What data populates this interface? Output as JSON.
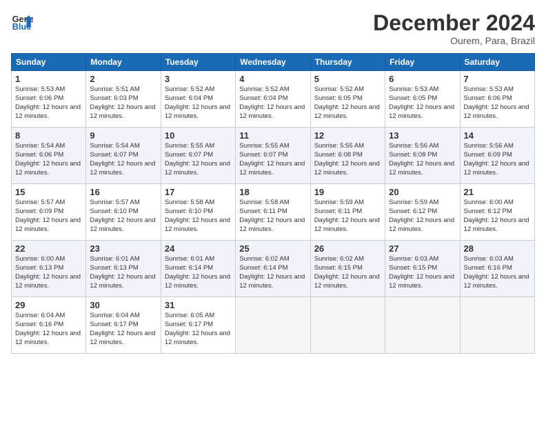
{
  "logo": {
    "line1": "General",
    "line2": "Blue"
  },
  "header": {
    "month": "December 2024",
    "location": "Ourem, Para, Brazil"
  },
  "weekdays": [
    "Sunday",
    "Monday",
    "Tuesday",
    "Wednesday",
    "Thursday",
    "Friday",
    "Saturday"
  ],
  "days": [
    {
      "num": "",
      "info": ""
    },
    {
      "num": "",
      "info": ""
    },
    {
      "num": "",
      "info": ""
    },
    {
      "num": "",
      "info": ""
    },
    {
      "num": "",
      "info": ""
    },
    {
      "num": "",
      "info": ""
    },
    {
      "num": "1",
      "sunrise": "5:53 AM",
      "sunset": "6:06 PM",
      "daylight": "12 hours and 12 minutes."
    },
    {
      "num": "2",
      "sunrise": "5:51 AM",
      "sunset": "6:03 PM",
      "daylight": "12 hours and 12 minutes."
    },
    {
      "num": "3",
      "sunrise": "5:52 AM",
      "sunset": "6:04 PM",
      "daylight": "12 hours and 12 minutes."
    },
    {
      "num": "4",
      "sunrise": "5:52 AM",
      "sunset": "6:04 PM",
      "daylight": "12 hours and 12 minutes."
    },
    {
      "num": "5",
      "sunrise": "5:52 AM",
      "sunset": "6:05 PM",
      "daylight": "12 hours and 12 minutes."
    },
    {
      "num": "6",
      "sunrise": "5:53 AM",
      "sunset": "6:05 PM",
      "daylight": "12 hours and 12 minutes."
    },
    {
      "num": "7",
      "sunrise": "5:53 AM",
      "sunset": "6:06 PM",
      "daylight": "12 hours and 12 minutes."
    },
    {
      "num": "8",
      "sunrise": "5:54 AM",
      "sunset": "6:06 PM",
      "daylight": "12 hours and 12 minutes."
    },
    {
      "num": "9",
      "sunrise": "5:54 AM",
      "sunset": "6:07 PM",
      "daylight": "12 hours and 12 minutes."
    },
    {
      "num": "10",
      "sunrise": "5:55 AM",
      "sunset": "6:07 PM",
      "daylight": "12 hours and 12 minutes."
    },
    {
      "num": "11",
      "sunrise": "5:55 AM",
      "sunset": "6:07 PM",
      "daylight": "12 hours and 12 minutes."
    },
    {
      "num": "12",
      "sunrise": "5:55 AM",
      "sunset": "6:08 PM",
      "daylight": "12 hours and 12 minutes."
    },
    {
      "num": "13",
      "sunrise": "5:56 AM",
      "sunset": "6:08 PM",
      "daylight": "12 hours and 12 minutes."
    },
    {
      "num": "14",
      "sunrise": "5:56 AM",
      "sunset": "6:09 PM",
      "daylight": "12 hours and 12 minutes."
    },
    {
      "num": "15",
      "sunrise": "5:57 AM",
      "sunset": "6:09 PM",
      "daylight": "12 hours and 12 minutes."
    },
    {
      "num": "16",
      "sunrise": "5:57 AM",
      "sunset": "6:10 PM",
      "daylight": "12 hours and 12 minutes."
    },
    {
      "num": "17",
      "sunrise": "5:58 AM",
      "sunset": "6:10 PM",
      "daylight": "12 hours and 12 minutes."
    },
    {
      "num": "18",
      "sunrise": "5:58 AM",
      "sunset": "6:11 PM",
      "daylight": "12 hours and 12 minutes."
    },
    {
      "num": "19",
      "sunrise": "5:59 AM",
      "sunset": "6:11 PM",
      "daylight": "12 hours and 12 minutes."
    },
    {
      "num": "20",
      "sunrise": "5:59 AM",
      "sunset": "6:12 PM",
      "daylight": "12 hours and 12 minutes."
    },
    {
      "num": "21",
      "sunrise": "6:00 AM",
      "sunset": "6:12 PM",
      "daylight": "12 hours and 12 minutes."
    },
    {
      "num": "22",
      "sunrise": "6:00 AM",
      "sunset": "6:13 PM",
      "daylight": "12 hours and 12 minutes."
    },
    {
      "num": "23",
      "sunrise": "6:01 AM",
      "sunset": "6:13 PM",
      "daylight": "12 hours and 12 minutes."
    },
    {
      "num": "24",
      "sunrise": "6:01 AM",
      "sunset": "6:14 PM",
      "daylight": "12 hours and 12 minutes."
    },
    {
      "num": "25",
      "sunrise": "6:02 AM",
      "sunset": "6:14 PM",
      "daylight": "12 hours and 12 minutes."
    },
    {
      "num": "26",
      "sunrise": "6:02 AM",
      "sunset": "6:15 PM",
      "daylight": "12 hours and 12 minutes."
    },
    {
      "num": "27",
      "sunrise": "6:03 AM",
      "sunset": "6:15 PM",
      "daylight": "12 hours and 12 minutes."
    },
    {
      "num": "28",
      "sunrise": "6:03 AM",
      "sunset": "6:16 PM",
      "daylight": "12 hours and 12 minutes."
    },
    {
      "num": "29",
      "sunrise": "6:04 AM",
      "sunset": "6:16 PM",
      "daylight": "12 hours and 12 minutes."
    },
    {
      "num": "30",
      "sunrise": "6:04 AM",
      "sunset": "6:17 PM",
      "daylight": "12 hours and 12 minutes."
    },
    {
      "num": "31",
      "sunrise": "6:05 AM",
      "sunset": "6:17 PM",
      "daylight": "12 hours and 12 minutes."
    }
  ]
}
